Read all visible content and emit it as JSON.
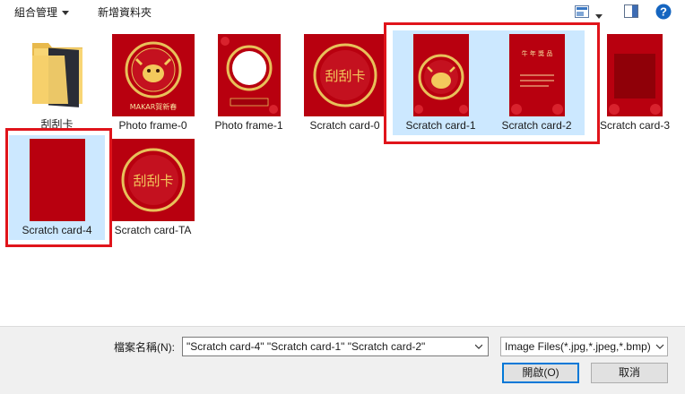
{
  "toolbar": {
    "organize_label": "組合管理",
    "new_folder_label": "新增資料夾"
  },
  "items": [
    {
      "label": "刮刮卡",
      "kind": "folder",
      "selected": false
    },
    {
      "label": "Photo frame-0",
      "kind": "photo-frame-0",
      "selected": false,
      "image_text": "MAKAR賀新春"
    },
    {
      "label": "Photo frame-1",
      "kind": "photo-frame-1",
      "selected": false
    },
    {
      "label": "Scratch card-0",
      "kind": "scratch-0",
      "selected": false,
      "image_text": "刮刮卡"
    },
    {
      "label": "Scratch card-1",
      "kind": "scratch-1",
      "selected": true
    },
    {
      "label": "Scratch card-2",
      "kind": "scratch-2",
      "selected": true,
      "image_text": "牛 年 獎 品"
    },
    {
      "label": "Scratch card-3",
      "kind": "scratch-3",
      "selected": false
    },
    {
      "label": "Scratch card-4",
      "kind": "scratch-4",
      "selected": true
    },
    {
      "label": "Scratch card-TA",
      "kind": "scratch-ta",
      "selected": false,
      "image_text": "刮刮卡"
    }
  ],
  "footer": {
    "filename_label": "檔案名稱(N):",
    "filename_value": "\"Scratch card-4\" \"Scratch card-1\" \"Scratch card-2\"",
    "filetype_value": "Image Files(*.jpg,*.jpeg,*.bmp)",
    "open_label": "開啟(O)",
    "cancel_label": "取消"
  },
  "colors": {
    "selection": "#cce8ff",
    "highlight_box": "#e0141b",
    "card_red": "#b8000f",
    "gold": "#e8c15a",
    "help_blue": "#1565c0"
  }
}
